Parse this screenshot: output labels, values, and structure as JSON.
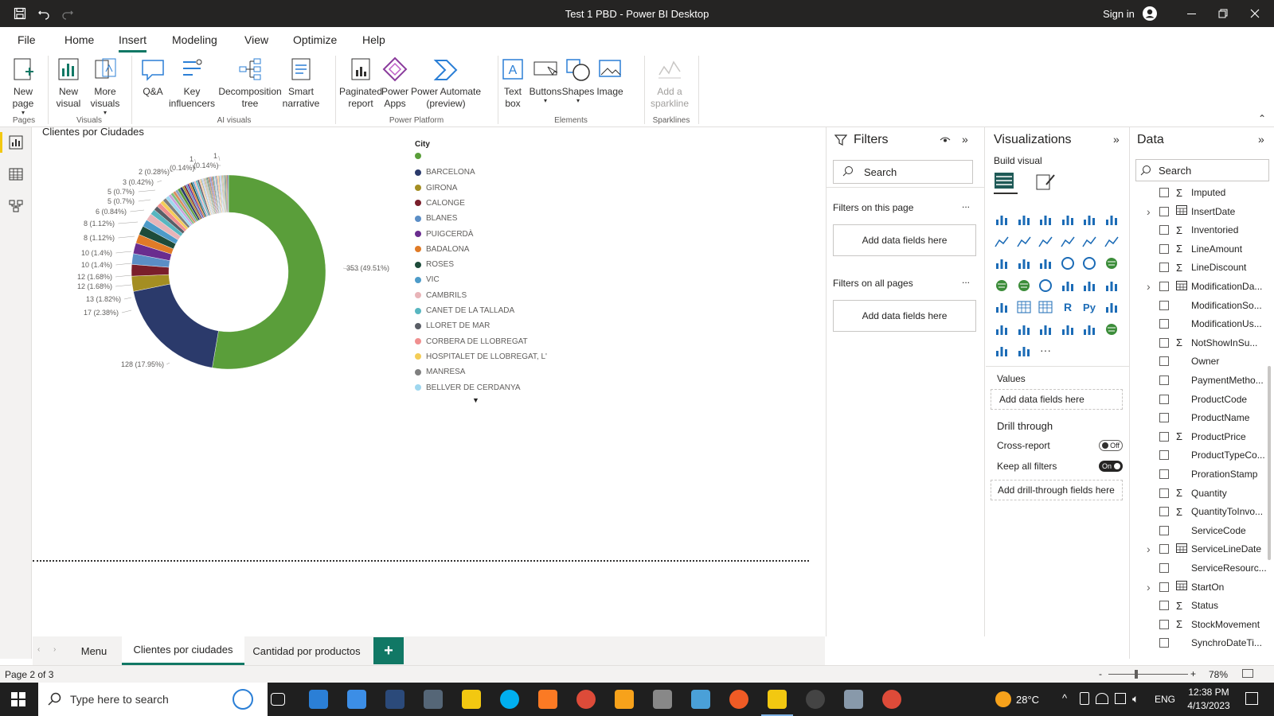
{
  "window": {
    "title": "Test 1 PBD - Power BI Desktop",
    "sign_in": "Sign in"
  },
  "menu": {
    "tabs": [
      "File",
      "Home",
      "Insert",
      "Modeling",
      "View",
      "Optimize",
      "Help"
    ],
    "active": "Insert"
  },
  "ribbon": {
    "buttons": [
      {
        "label": "New\npage",
        "name": "new-page-button",
        "icon": "new-page-icon"
      },
      {
        "label": "New\nvisual",
        "name": "new-visual-button",
        "icon": "new-visual-icon"
      },
      {
        "label": "More\nvisuals",
        "name": "more-visuals-button",
        "icon": "more-visuals-icon"
      },
      {
        "label": "Q&A",
        "name": "qa-button",
        "icon": "qa-icon"
      },
      {
        "label": "Key\ninfluencers",
        "name": "key-influencers-button",
        "icon": "key-influencers-icon"
      },
      {
        "label": "Decomposition\ntree",
        "name": "decomposition-tree-button",
        "icon": "decomposition-tree-icon"
      },
      {
        "label": "Smart\nnarrative",
        "name": "smart-narrative-button",
        "icon": "smart-narrative-icon"
      },
      {
        "label": "Paginated\nreport",
        "name": "paginated-report-button",
        "icon": "paginated-report-icon"
      },
      {
        "label": "Power\nApps",
        "name": "power-apps-button",
        "icon": "power-apps-icon"
      },
      {
        "label": "Power Automate\n(preview)",
        "name": "power-automate-button",
        "icon": "power-automate-icon"
      },
      {
        "label": "Text\nbox",
        "name": "text-box-button",
        "icon": "text-box-icon"
      },
      {
        "label": "Buttons",
        "name": "buttons-button",
        "icon": "buttons-icon"
      },
      {
        "label": "Shapes",
        "name": "shapes-button",
        "icon": "shapes-icon"
      },
      {
        "label": "Image",
        "name": "image-button",
        "icon": "image-icon"
      },
      {
        "label": "Add a\nsparkline",
        "name": "add-sparkline-button",
        "icon": "sparkline-icon"
      }
    ],
    "groups": [
      "Pages",
      "Visuals",
      "AI visuals",
      "Power Platform",
      "Elements",
      "Sparklines"
    ]
  },
  "visual": {
    "title": "Clientes por Ciudades",
    "legend_title": "City"
  },
  "chart_data": {
    "type": "pie",
    "title": "Clientes por Ciudades",
    "legend_title": "City",
    "categories": [
      "",
      "BARCELONA",
      "GIRONA",
      "CALONGE",
      "BLANES",
      "PUIGCERDÀ",
      "BADALONA",
      "ROSES",
      "VIC",
      "CAMBRILS",
      "CANET DE LA TALLADA",
      "LLORET DE MAR",
      "CORBERA DE LLOBREGAT",
      "HOSPITALET DE LLOBREGAT, L'",
      "MANRESA",
      "BELLVER DE CERDANYA"
    ],
    "legend_colors": [
      "#5a9e3a",
      "#2b3a6b",
      "#a48e22",
      "#7a1f2b",
      "#5b8ec6",
      "#6a2d8f",
      "#e07b27",
      "#1d4b3a",
      "#4d9bc9",
      "#e8b4b8",
      "#58b6c0",
      "#5a5e66",
      "#f08f8f",
      "#f4cd57",
      "#7f7f7f",
      "#9fd7ef"
    ],
    "data_labels": [
      "353 (49.51%)",
      "128 (17.95%)",
      "17 (2.38%)",
      "13 (1.82%)",
      "12 (1.68%)",
      "12 (1.68%)",
      "10 (1.4%)",
      "10 (1.4%)",
      "8 (1.12%)",
      "8 (1.12%)",
      "6 (0.84%)",
      "5 (0.7%)",
      "5 (0.7%)",
      "3 (0.42%)",
      "2 (0.28%)",
      "1",
      "(0.14%)",
      "1",
      "(0.14%)"
    ],
    "values": [
      353,
      128,
      17,
      13,
      12,
      12,
      10,
      10,
      8,
      8,
      6,
      5,
      5,
      4,
      4,
      4,
      3,
      3,
      3,
      3,
      3,
      3,
      2,
      2,
      2,
      2,
      2,
      2,
      2,
      2,
      2,
      2,
      1,
      1,
      1,
      1,
      1,
      1,
      1,
      1,
      1,
      1,
      1,
      1,
      1,
      1,
      1,
      1,
      1,
      1,
      1,
      1,
      1,
      1,
      1,
      1,
      1,
      1,
      1,
      1,
      1,
      1,
      1,
      1,
      1
    ]
  },
  "filters": {
    "title": "Filters",
    "search": "Search",
    "on_this_page": "Filters on this page",
    "on_all_pages": "Filters on all pages",
    "add_fields": "Add data fields here",
    "more": "..."
  },
  "visualizations": {
    "title": "Visualizations",
    "build_visual": "Build visual",
    "values": "Values",
    "add_fields": "Add data fields here",
    "drill_through": "Drill through",
    "cross_report": "Cross-report",
    "cross_report_state": "Off",
    "keep_all_filters": "Keep all filters",
    "keep_all_filters_state": "On",
    "add_drill": "Add drill-through fields here",
    "more_icon": "..."
  },
  "data": {
    "title": "Data",
    "search": "Search",
    "fields": [
      {
        "label": "Imputed",
        "sigma": true,
        "table": false,
        "expand": false
      },
      {
        "label": "InsertDate",
        "sigma": false,
        "table": true,
        "expand": true
      },
      {
        "label": "Inventoried",
        "sigma": true,
        "table": false,
        "expand": false
      },
      {
        "label": "LineAmount",
        "sigma": true,
        "table": false,
        "expand": false
      },
      {
        "label": "LineDiscount",
        "sigma": true,
        "table": false,
        "expand": false
      },
      {
        "label": "ModificationDa...",
        "sigma": false,
        "table": true,
        "expand": true
      },
      {
        "label": "ModificationSo...",
        "sigma": false,
        "table": false,
        "expand": false
      },
      {
        "label": "ModificationUs...",
        "sigma": false,
        "table": false,
        "expand": false
      },
      {
        "label": "NotShowInSu...",
        "sigma": true,
        "table": false,
        "expand": false
      },
      {
        "label": "Owner",
        "sigma": false,
        "table": false,
        "expand": false
      },
      {
        "label": "PaymentMetho...",
        "sigma": false,
        "table": false,
        "expand": false
      },
      {
        "label": "ProductCode",
        "sigma": false,
        "table": false,
        "expand": false
      },
      {
        "label": "ProductName",
        "sigma": false,
        "table": false,
        "expand": false
      },
      {
        "label": "ProductPrice",
        "sigma": true,
        "table": false,
        "expand": false
      },
      {
        "label": "ProductTypeCo...",
        "sigma": false,
        "table": false,
        "expand": false
      },
      {
        "label": "ProrationStamp",
        "sigma": false,
        "table": false,
        "expand": false
      },
      {
        "label": "Quantity",
        "sigma": true,
        "table": false,
        "expand": false
      },
      {
        "label": "QuantityToInvo...",
        "sigma": true,
        "table": false,
        "expand": false
      },
      {
        "label": "ServiceCode",
        "sigma": false,
        "table": false,
        "expand": false
      },
      {
        "label": "ServiceLineDate",
        "sigma": false,
        "table": true,
        "expand": true
      },
      {
        "label": "ServiceResourc...",
        "sigma": false,
        "table": false,
        "expand": false
      },
      {
        "label": "StartOn",
        "sigma": false,
        "table": true,
        "expand": true
      },
      {
        "label": "Status",
        "sigma": true,
        "table": false,
        "expand": false
      },
      {
        "label": "StockMovement",
        "sigma": true,
        "table": false,
        "expand": false
      },
      {
        "label": "SynchroDateTi...",
        "sigma": false,
        "table": false,
        "expand": false
      }
    ]
  },
  "pages": {
    "tabs": [
      "Menu",
      "Clientes por ciudades",
      "Cantidad por productos"
    ],
    "active": "Clientes por ciudades",
    "add": "+"
  },
  "status": {
    "page": "Page 2 of 3",
    "zoom": "78%"
  },
  "taskbar": {
    "search_placeholder": "Type here to search",
    "weather": "28°C",
    "lang": "ENG",
    "time": "12:38 PM",
    "date": "4/13/2023"
  }
}
